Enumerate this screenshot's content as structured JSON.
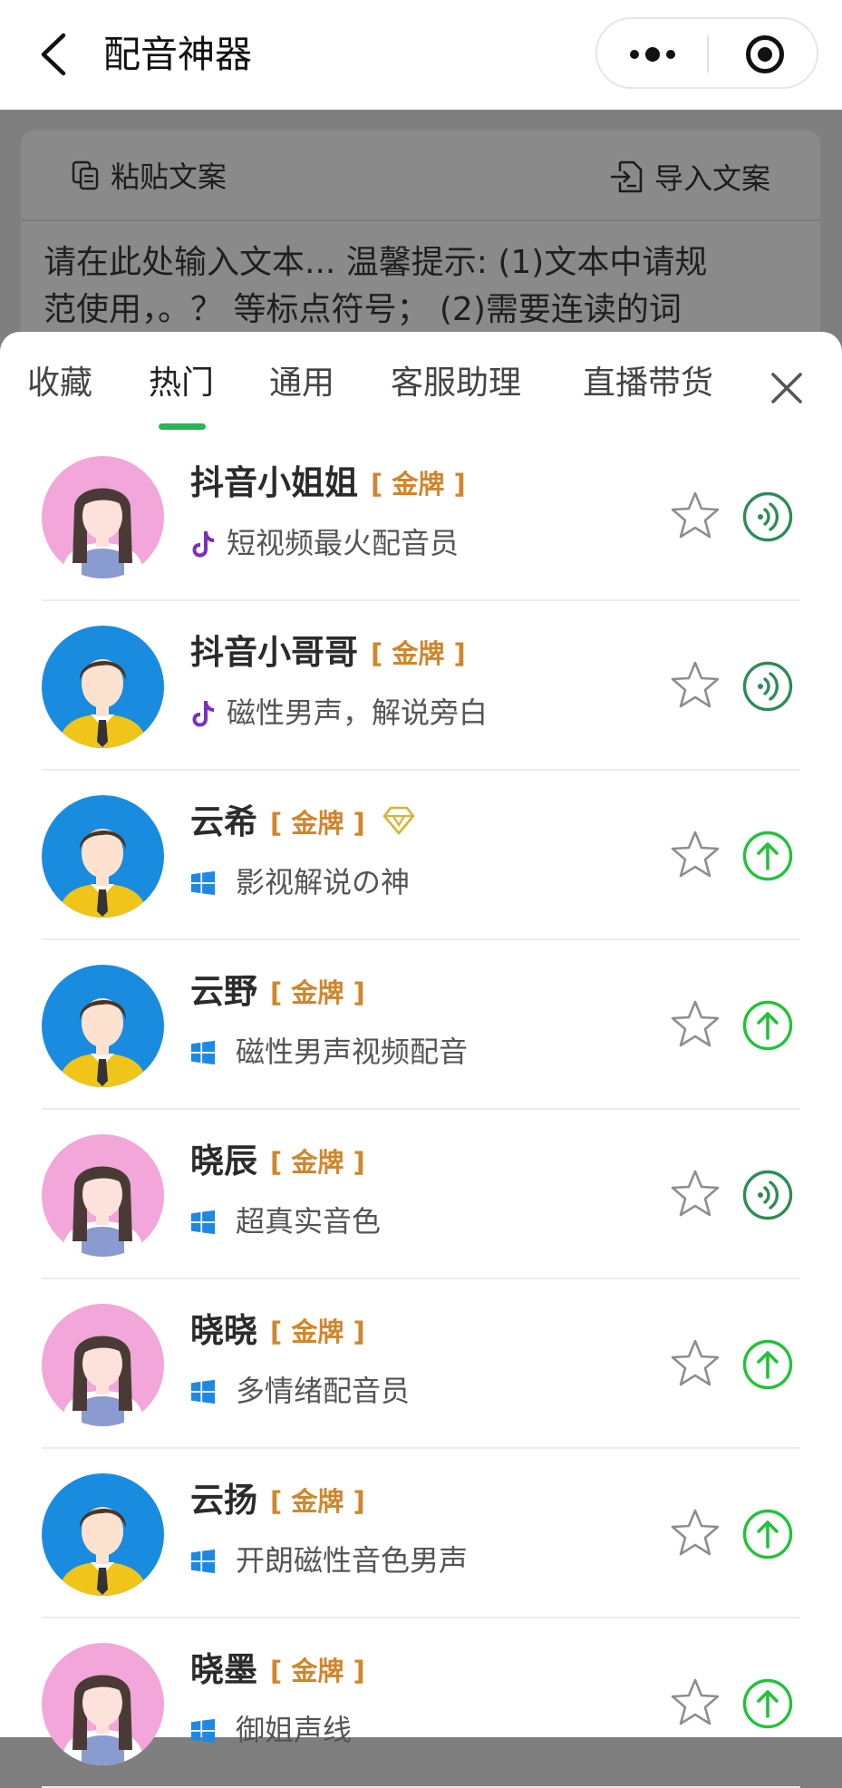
{
  "navbar": {
    "title": "配音神器",
    "back_icon": "chevron-left-icon",
    "more_icon": "more-dots-icon",
    "close_icon": "target-circle-icon"
  },
  "editor": {
    "paste_label": "粘贴文案",
    "import_label": "导入文案",
    "placeholder_line1": "请在此处输入文本... 温馨提示: (1)文本中请规",
    "placeholder_line2": "范使用，。？ 等标点符号； (2)需要连读的词"
  },
  "tabs": [
    {
      "label": "收藏"
    },
    {
      "label": "热门",
      "active": true
    },
    {
      "label": "通用"
    },
    {
      "label": "客服助理"
    },
    {
      "label": "直播带货"
    }
  ],
  "colors": {
    "accent_green": "#2db257",
    "gold_badge": "#d0862c",
    "tiktok_purple": "#7b2fbe",
    "windows_blue": "#1e88e5",
    "play_green": "#2e8b57",
    "upload_green": "#23c23a"
  },
  "voices": [
    {
      "name": "抖音小姐姐",
      "badge": "[ 金牌 ]",
      "desc": "短视频最火配音员",
      "gender": "female",
      "platform": "tiktok-icon",
      "action": "play-sound-icon",
      "diamond": false
    },
    {
      "name": "抖音小哥哥",
      "badge": "[ 金牌 ]",
      "desc": "磁性男声，解说旁白",
      "gender": "male",
      "platform": "tiktok-icon",
      "action": "play-sound-icon",
      "diamond": false
    },
    {
      "name": "云希",
      "badge": "[ 金牌 ]",
      "desc": "影视解说の神",
      "gender": "male",
      "platform": "windows-icon",
      "action": "upload-arrow-icon",
      "diamond": true
    },
    {
      "name": "云野",
      "badge": "[ 金牌 ]",
      "desc": "磁性男声视频配音",
      "gender": "male",
      "platform": "windows-icon",
      "action": "upload-arrow-icon",
      "diamond": false
    },
    {
      "name": "晓辰",
      "badge": "[ 金牌 ]",
      "desc": "超真实音色",
      "gender": "female",
      "platform": "windows-icon",
      "action": "play-sound-icon",
      "diamond": false
    },
    {
      "name": "晓晓",
      "badge": "[ 金牌 ]",
      "desc": "多情绪配音员",
      "gender": "female",
      "platform": "windows-icon",
      "action": "upload-arrow-icon",
      "diamond": false
    },
    {
      "name": "云扬",
      "badge": "[ 金牌 ]",
      "desc": "开朗磁性音色男声",
      "gender": "male",
      "platform": "windows-icon",
      "action": "upload-arrow-icon",
      "diamond": false
    },
    {
      "name": "晓墨",
      "badge": "[ 金牌 ]",
      "desc": "御姐声线",
      "gender": "female",
      "platform": "windows-icon",
      "action": "upload-arrow-icon",
      "diamond": false
    }
  ]
}
